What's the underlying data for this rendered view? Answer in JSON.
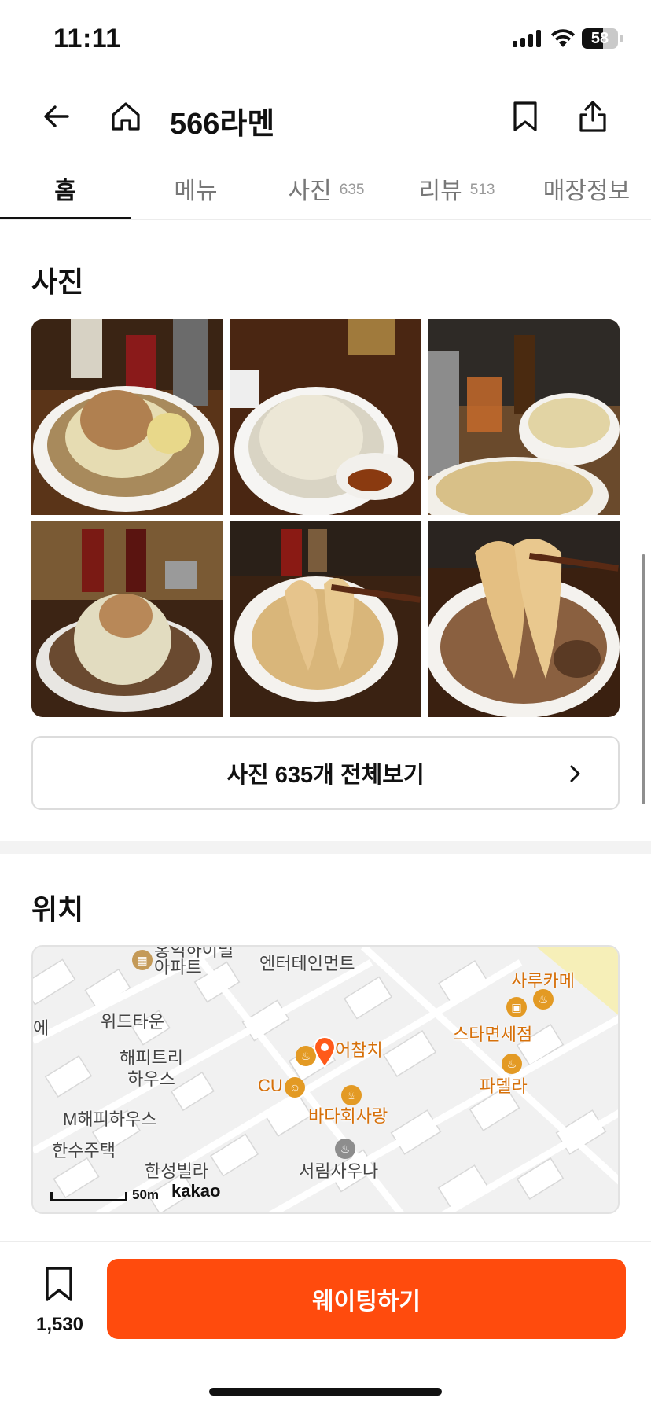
{
  "status_bar": {
    "time": "11:11",
    "battery": "58",
    "battery_level": 0.58
  },
  "header": {
    "title": "566라멘",
    "icons": [
      "back-arrow-icon",
      "home-icon",
      "bookmark-icon",
      "share-icon"
    ]
  },
  "tabs": [
    {
      "label": "홈",
      "count": "",
      "active": true
    },
    {
      "label": "메뉴",
      "count": ""
    },
    {
      "label": "사진",
      "count": "635"
    },
    {
      "label": "리뷰",
      "count": "513"
    },
    {
      "label": "매장정보",
      "count": ""
    }
  ],
  "photos_section": {
    "title": "사진",
    "view_all_label": "사진 635개 전체보기"
  },
  "location_section": {
    "title": "위치",
    "map_labels": {
      "apt": "홍익하이빌\n아파트",
      "entertainment": "엔터테인먼트",
      "saru": "사루카메",
      "e": "에",
      "widtown": "위드타운",
      "starmyeon": "스타면세점",
      "chamchi": "어참치",
      "happytree": "해피트리\n하우스",
      "padella": "파델라",
      "cu": "CU",
      "badahoe": "바다회사랑",
      "mhappy": "M해피하우스",
      "hansu": "한수주택",
      "hanseong": "한성빌라",
      "seorim": "서림사우나"
    },
    "scale": "50m",
    "provider": "kakao"
  },
  "bottom_bar": {
    "save_count": "1,530",
    "waiting_label": "웨이팅하기"
  },
  "colors": {
    "accent": "#ff4b0d",
    "map_orange": "#d6700a"
  }
}
